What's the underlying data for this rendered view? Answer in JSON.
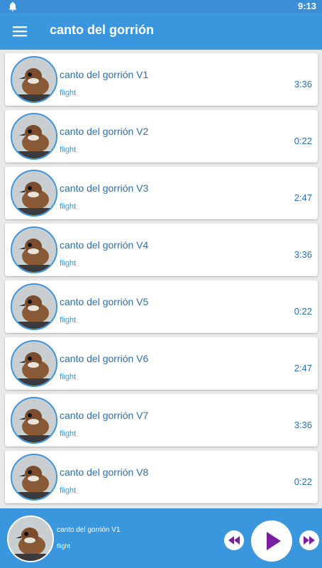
{
  "status": {
    "time": "9:13",
    "bell_icon": "bell-icon"
  },
  "header": {
    "title": "canto del gorrión",
    "menu_icon": "hamburger-menu-icon"
  },
  "tracks": [
    {
      "name": "canto del gorrión V1",
      "sub": "flight",
      "duration": "3:36"
    },
    {
      "name": "canto del gorrión V2",
      "sub": "flight",
      "duration": "0:22"
    },
    {
      "name": "canto del gorrión V3",
      "sub": "flight",
      "duration": "2:47"
    },
    {
      "name": "canto del gorrión V4",
      "sub": "flight",
      "duration": "3:36"
    },
    {
      "name": "canto del gorrión V5",
      "sub": "flight",
      "duration": "0:22"
    },
    {
      "name": "canto del gorrión V6",
      "sub": "flight",
      "duration": "2:47"
    },
    {
      "name": "canto del gorrión V7",
      "sub": "flight",
      "duration": "3:36"
    },
    {
      "name": "canto del gorrión V8",
      "sub": "flight",
      "duration": "0:22"
    }
  ],
  "player": {
    "name": "canto del gorrión V1",
    "sub": "flight",
    "prev_icon": "rewind-icon",
    "play_icon": "play-icon",
    "next_icon": "fast-forward-icon"
  },
  "colors": {
    "app_bar": "#3a96dd",
    "status_bar": "#3a8fd8",
    "accent_text": "#2a6fb0",
    "player_controls": "#7b1fa2"
  }
}
